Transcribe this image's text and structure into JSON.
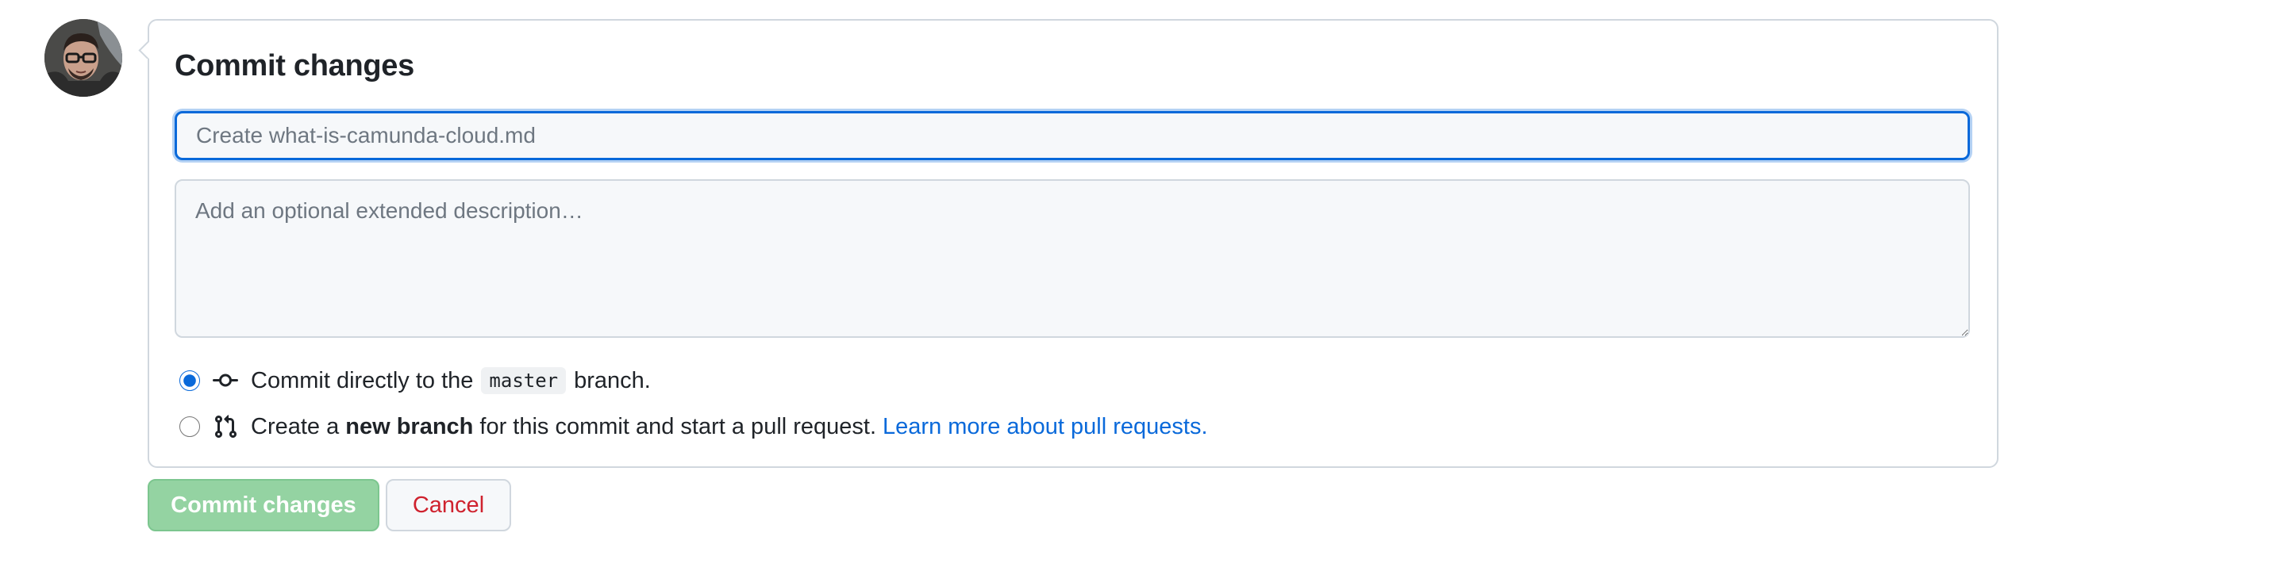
{
  "avatar": {
    "alt": "User avatar"
  },
  "commit": {
    "title": "Commit changes",
    "summary_placeholder": "Create what-is-camunda-cloud.md",
    "summary_value": "",
    "description_placeholder": "Add an optional extended description…",
    "description_value": ""
  },
  "options": {
    "direct": {
      "selected": true,
      "icon": "git-commit-icon",
      "prefix": "Commit directly to the",
      "branch": "master",
      "suffix": "branch."
    },
    "new_branch": {
      "selected": false,
      "icon": "git-pull-request-icon",
      "prefix": "Create a",
      "bold": "new branch",
      "suffix": "for this commit and start a pull request.",
      "link": "Learn more about pull requests."
    }
  },
  "buttons": {
    "commit_label": "Commit changes",
    "cancel_label": "Cancel"
  },
  "colors": {
    "accent": "#0969da",
    "commit_button": "#94d3a2",
    "cancel_text": "#cf222e",
    "border": "#d0d7de"
  }
}
